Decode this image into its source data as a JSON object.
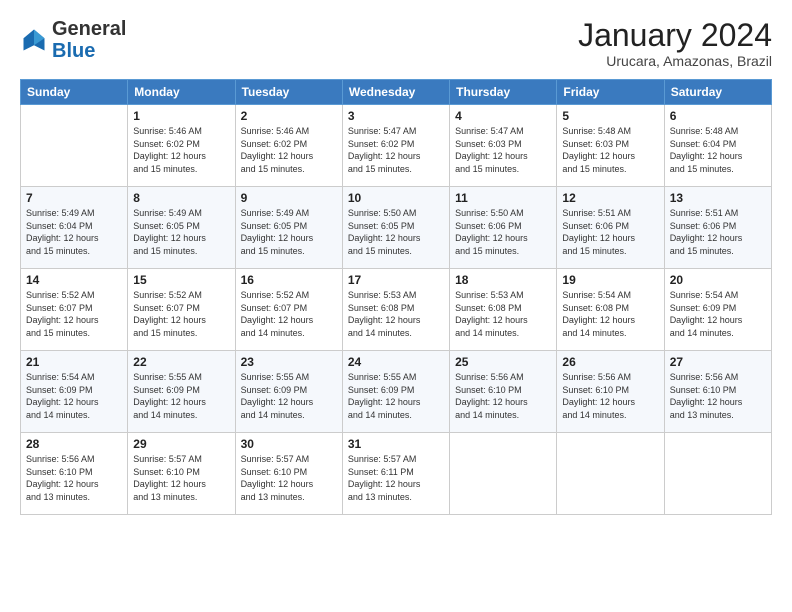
{
  "header": {
    "logo_general": "General",
    "logo_blue": "Blue",
    "month_title": "January 2024",
    "subtitle": "Urucara, Amazonas, Brazil"
  },
  "days_of_week": [
    "Sunday",
    "Monday",
    "Tuesday",
    "Wednesday",
    "Thursday",
    "Friday",
    "Saturday"
  ],
  "weeks": [
    [
      {
        "day": "",
        "info": ""
      },
      {
        "day": "1",
        "info": "Sunrise: 5:46 AM\nSunset: 6:02 PM\nDaylight: 12 hours\nand 15 minutes."
      },
      {
        "day": "2",
        "info": "Sunrise: 5:46 AM\nSunset: 6:02 PM\nDaylight: 12 hours\nand 15 minutes."
      },
      {
        "day": "3",
        "info": "Sunrise: 5:47 AM\nSunset: 6:02 PM\nDaylight: 12 hours\nand 15 minutes."
      },
      {
        "day": "4",
        "info": "Sunrise: 5:47 AM\nSunset: 6:03 PM\nDaylight: 12 hours\nand 15 minutes."
      },
      {
        "day": "5",
        "info": "Sunrise: 5:48 AM\nSunset: 6:03 PM\nDaylight: 12 hours\nand 15 minutes."
      },
      {
        "day": "6",
        "info": "Sunrise: 5:48 AM\nSunset: 6:04 PM\nDaylight: 12 hours\nand 15 minutes."
      }
    ],
    [
      {
        "day": "7",
        "info": "Sunrise: 5:49 AM\nSunset: 6:04 PM\nDaylight: 12 hours\nand 15 minutes."
      },
      {
        "day": "8",
        "info": "Sunrise: 5:49 AM\nSunset: 6:05 PM\nDaylight: 12 hours\nand 15 minutes."
      },
      {
        "day": "9",
        "info": "Sunrise: 5:49 AM\nSunset: 6:05 PM\nDaylight: 12 hours\nand 15 minutes."
      },
      {
        "day": "10",
        "info": "Sunrise: 5:50 AM\nSunset: 6:05 PM\nDaylight: 12 hours\nand 15 minutes."
      },
      {
        "day": "11",
        "info": "Sunrise: 5:50 AM\nSunset: 6:06 PM\nDaylight: 12 hours\nand 15 minutes."
      },
      {
        "day": "12",
        "info": "Sunrise: 5:51 AM\nSunset: 6:06 PM\nDaylight: 12 hours\nand 15 minutes."
      },
      {
        "day": "13",
        "info": "Sunrise: 5:51 AM\nSunset: 6:06 PM\nDaylight: 12 hours\nand 15 minutes."
      }
    ],
    [
      {
        "day": "14",
        "info": "Sunrise: 5:52 AM\nSunset: 6:07 PM\nDaylight: 12 hours\nand 15 minutes."
      },
      {
        "day": "15",
        "info": "Sunrise: 5:52 AM\nSunset: 6:07 PM\nDaylight: 12 hours\nand 15 minutes."
      },
      {
        "day": "16",
        "info": "Sunrise: 5:52 AM\nSunset: 6:07 PM\nDaylight: 12 hours\nand 14 minutes."
      },
      {
        "day": "17",
        "info": "Sunrise: 5:53 AM\nSunset: 6:08 PM\nDaylight: 12 hours\nand 14 minutes."
      },
      {
        "day": "18",
        "info": "Sunrise: 5:53 AM\nSunset: 6:08 PM\nDaylight: 12 hours\nand 14 minutes."
      },
      {
        "day": "19",
        "info": "Sunrise: 5:54 AM\nSunset: 6:08 PM\nDaylight: 12 hours\nand 14 minutes."
      },
      {
        "day": "20",
        "info": "Sunrise: 5:54 AM\nSunset: 6:09 PM\nDaylight: 12 hours\nand 14 minutes."
      }
    ],
    [
      {
        "day": "21",
        "info": "Sunrise: 5:54 AM\nSunset: 6:09 PM\nDaylight: 12 hours\nand 14 minutes."
      },
      {
        "day": "22",
        "info": "Sunrise: 5:55 AM\nSunset: 6:09 PM\nDaylight: 12 hours\nand 14 minutes."
      },
      {
        "day": "23",
        "info": "Sunrise: 5:55 AM\nSunset: 6:09 PM\nDaylight: 12 hours\nand 14 minutes."
      },
      {
        "day": "24",
        "info": "Sunrise: 5:55 AM\nSunset: 6:09 PM\nDaylight: 12 hours\nand 14 minutes."
      },
      {
        "day": "25",
        "info": "Sunrise: 5:56 AM\nSunset: 6:10 PM\nDaylight: 12 hours\nand 14 minutes."
      },
      {
        "day": "26",
        "info": "Sunrise: 5:56 AM\nSunset: 6:10 PM\nDaylight: 12 hours\nand 14 minutes."
      },
      {
        "day": "27",
        "info": "Sunrise: 5:56 AM\nSunset: 6:10 PM\nDaylight: 12 hours\nand 13 minutes."
      }
    ],
    [
      {
        "day": "28",
        "info": "Sunrise: 5:56 AM\nSunset: 6:10 PM\nDaylight: 12 hours\nand 13 minutes."
      },
      {
        "day": "29",
        "info": "Sunrise: 5:57 AM\nSunset: 6:10 PM\nDaylight: 12 hours\nand 13 minutes."
      },
      {
        "day": "30",
        "info": "Sunrise: 5:57 AM\nSunset: 6:10 PM\nDaylight: 12 hours\nand 13 minutes."
      },
      {
        "day": "31",
        "info": "Sunrise: 5:57 AM\nSunset: 6:11 PM\nDaylight: 12 hours\nand 13 minutes."
      },
      {
        "day": "",
        "info": ""
      },
      {
        "day": "",
        "info": ""
      },
      {
        "day": "",
        "info": ""
      }
    ]
  ]
}
